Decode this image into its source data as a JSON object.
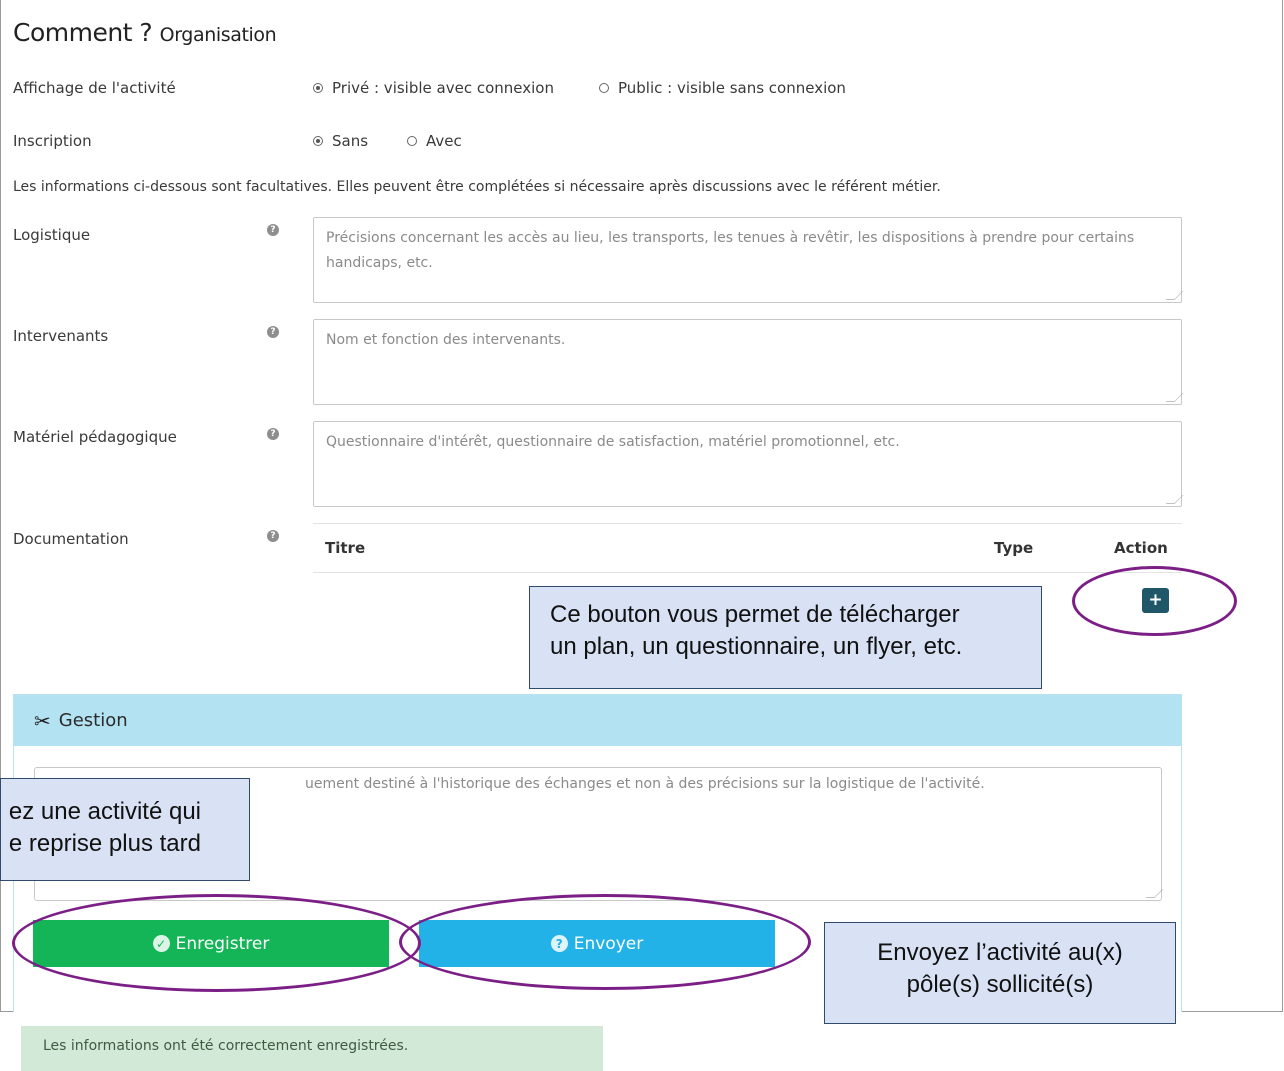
{
  "section": {
    "title": "Comment ?",
    "subtitle": "Organisation"
  },
  "display": {
    "label": "Affichage de l'activité",
    "options": [
      {
        "label": "Privé : visible avec connexion",
        "checked": true
      },
      {
        "label": "Public : visible sans connexion",
        "checked": false
      }
    ]
  },
  "registration": {
    "label": "Inscription",
    "options": [
      {
        "label": "Sans",
        "checked": true
      },
      {
        "label": "Avec",
        "checked": false
      }
    ]
  },
  "info_text": "Les informations ci-dessous sont facultatives. Elles peuvent être complétées si nécessaire après discussions avec le référent métier.",
  "help_glyph": "?",
  "fields": [
    {
      "label": "Logistique",
      "placeholder": "Précisions concernant les accès au lieu, les transports, les tenues à revêtir, les dispositions à prendre pour certains handicaps, etc."
    },
    {
      "label": "Intervenants",
      "placeholder": "Nom et fonction des intervenants."
    },
    {
      "label": "Matériel pédagogique",
      "placeholder": "Questionnaire d'intérêt, questionnaire de satisfaction, matériel promotionnel, etc."
    }
  ],
  "documentation": {
    "label": "Documentation",
    "columns": {
      "title": "Titre",
      "type": "Type",
      "action": "Action"
    },
    "add_label": "+"
  },
  "management": {
    "title": "Gestion",
    "textarea_placeholder": "uement destiné à l'historique des échanges et non à des précisions sur la logistique de l'activité.",
    "save_label": "Enregistrer",
    "send_label": "Envoyer",
    "save_icon": "✓",
    "send_icon": "?"
  },
  "callouts": {
    "upload": [
      "Ce bouton vous permet de télécharger",
      "un plan, un questionnaire, un flyer, etc."
    ],
    "save": [
      "ez une activité qui",
      "e reprise plus tard"
    ],
    "send": [
      "Envoyez l’activité au(x)",
      "pôle(s) sollicité(s)"
    ]
  },
  "alert": "Les informations ont été correctement enregistrées.",
  "colors": {
    "save_button": "#13b556",
    "send_button": "#23b2e8",
    "add_button": "#1f5768",
    "panel_header": "#b3e3f2",
    "callout_bg": "#d8e2f4",
    "highlight_ellipse": "#7b1f86",
    "success_alert": "#d1e9d6"
  }
}
